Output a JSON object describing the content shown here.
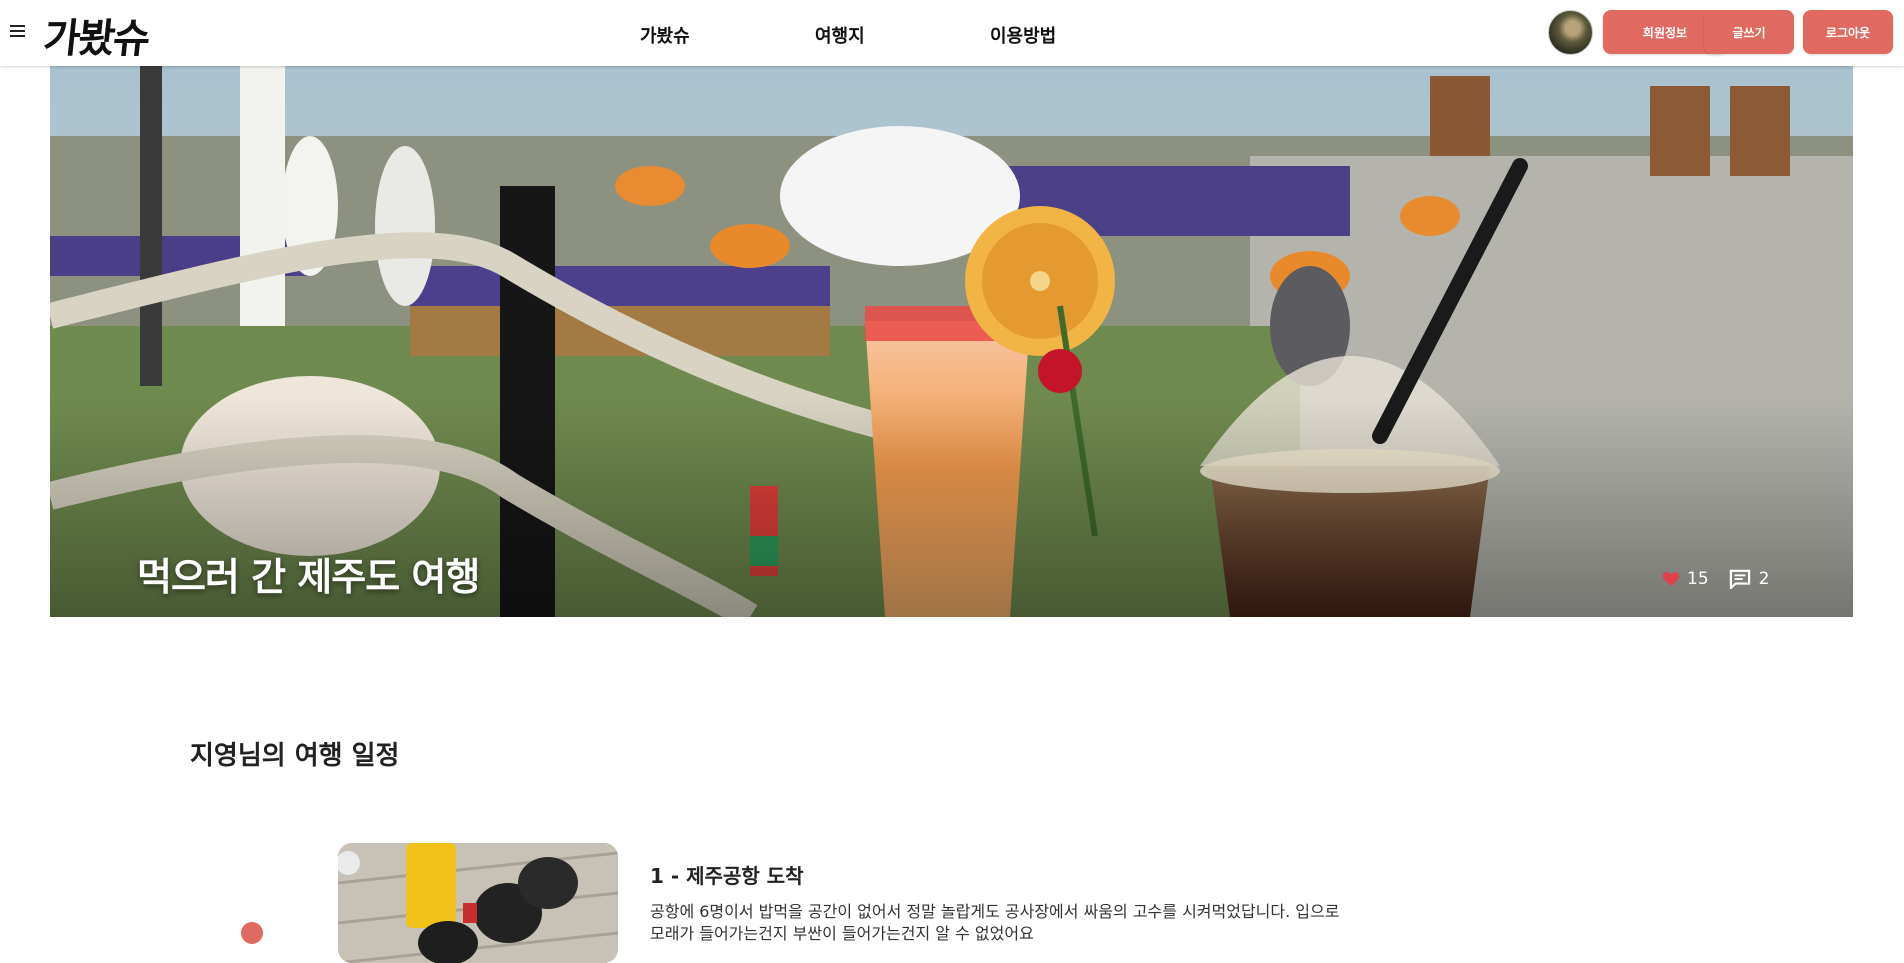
{
  "header": {
    "logo": "가봤슈",
    "menu_icon": "hamburger-menu-icon",
    "nav": [
      "가봤슈",
      "여행지",
      "이용방법"
    ],
    "buttons": {
      "member_info": "회원정보",
      "write": "글쓰기",
      "logout": "로그아웃"
    },
    "accent_color": "#e06a60"
  },
  "hero": {
    "title": "먹으러 간 제주도 여행",
    "likes": "15",
    "comments": "2",
    "like_icon": "heart-icon",
    "comment_icon": "comment-icon"
  },
  "itinerary": {
    "heading": "지영님의 여행 일정",
    "items": [
      {
        "title": "1 - 제주공항 도착",
        "description": "공항에 6명이서 밥먹을 공간이 없어서 정말 놀랍게도 공사장에서 싸움의 고수를 시켜먹었답니다. 입으로 모래가 들어가는건지 부싼이 들어가는건지 알 수 없었어요"
      }
    ]
  }
}
